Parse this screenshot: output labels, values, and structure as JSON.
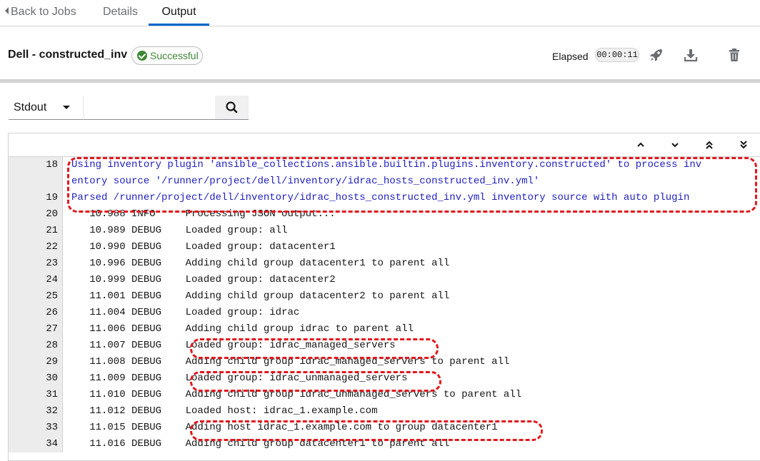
{
  "tabs": {
    "back": "Back to Jobs",
    "details": "Details",
    "output": "Output"
  },
  "header": {
    "title": "Dell - constructed_inv",
    "status": "Successful",
    "elapsed_label": "Elapsed",
    "elapsed_value": "00:00:11",
    "icons": [
      "rocket-icon",
      "download-icon",
      "trash-icon"
    ]
  },
  "search": {
    "select_value": "Stdout",
    "input_value": "",
    "placeholder": ""
  },
  "output_nav": [
    "caret-up-icon",
    "caret-down-icon",
    "double-caret-up-icon",
    "double-caret-down-icon"
  ],
  "lines": [
    {
      "num": "18",
      "text": "Using inventory plugin 'ansible_collections.ansible.builtin.plugins.inventory.constructed' to process inv",
      "style": "blue"
    },
    {
      "num": "",
      "text": "entory source '/runner/project/dell/inventory/idrac_hosts_constructed_inv.yml'",
      "style": "blue"
    },
    {
      "num": "19",
      "text": "Parsed /runner/project/dell/inventory/idrac_hosts_constructed_inv.yml inventory source with auto plugin",
      "style": "blue"
    },
    {
      "num": "20",
      "text": "   10.988 INFO     Processing JSON output...",
      "style": ""
    },
    {
      "num": "21",
      "text": "   10.989 DEBUG    Loaded group: all",
      "style": ""
    },
    {
      "num": "22",
      "text": "   10.990 DEBUG    Loaded group: datacenter1",
      "style": ""
    },
    {
      "num": "23",
      "text": "   10.996 DEBUG    Adding child group datacenter1 to parent all",
      "style": ""
    },
    {
      "num": "24",
      "text": "   10.999 DEBUG    Loaded group: datacenter2",
      "style": ""
    },
    {
      "num": "25",
      "text": "   11.001 DEBUG    Adding child group datacenter2 to parent all",
      "style": ""
    },
    {
      "num": "26",
      "text": "   11.004 DEBUG    Loaded group: idrac",
      "style": ""
    },
    {
      "num": "27",
      "text": "   11.006 DEBUG    Adding child group idrac to parent all",
      "style": ""
    },
    {
      "num": "28",
      "text": "   11.007 DEBUG    Loaded group: idrac_managed_servers",
      "style": ""
    },
    {
      "num": "29",
      "text": "   11.008 DEBUG    Adding child group idrac_managed_servers to parent all",
      "style": ""
    },
    {
      "num": "30",
      "text": "   11.009 DEBUG    Loaded group: idrac_unmanaged_servers",
      "style": ""
    },
    {
      "num": "31",
      "text": "   11.010 DEBUG    Adding child group idrac_unmanaged_servers to parent all",
      "style": ""
    },
    {
      "num": "32",
      "text": "   11.012 DEBUG    Loaded host: idrac_1.example.com",
      "style": ""
    },
    {
      "num": "33",
      "text": "   11.015 DEBUG    Adding host idrac_1.example.com to group datacenter1",
      "style": ""
    },
    {
      "num": "34",
      "text": "   11.016 DEBUG    Adding child group datacenter1 to parent all",
      "style": ""
    }
  ]
}
